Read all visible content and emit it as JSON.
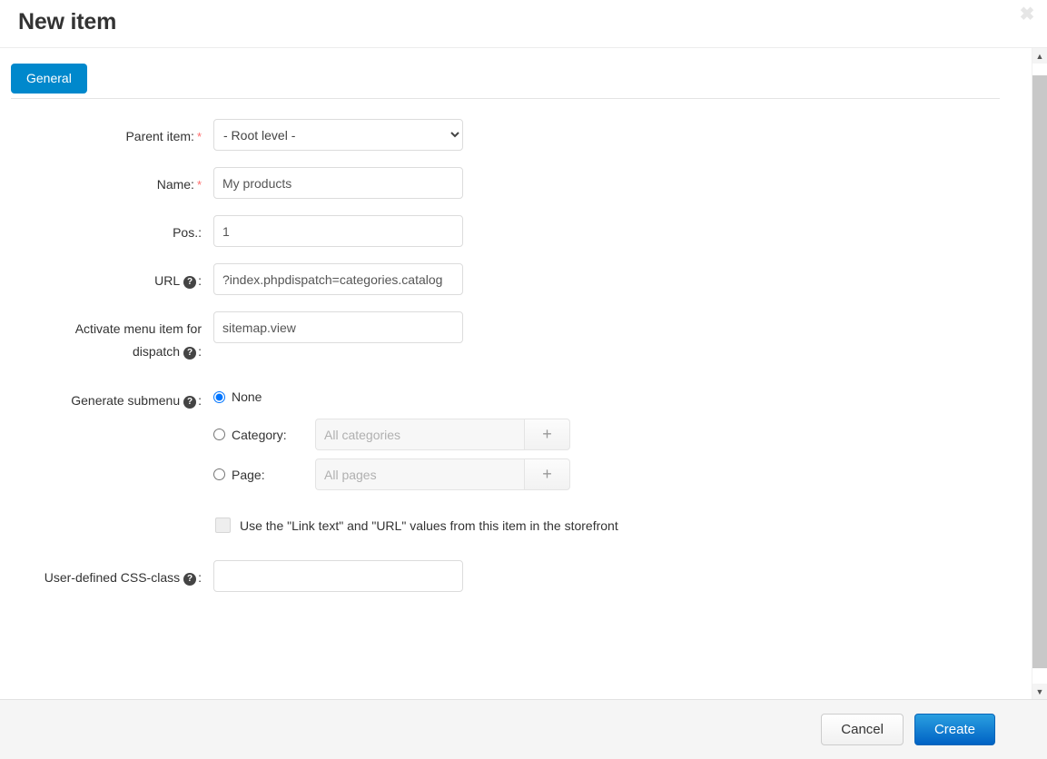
{
  "dialog": {
    "title": "New item",
    "close_label": "✖"
  },
  "tabs": [
    {
      "label": "General",
      "active": true
    }
  ],
  "form": {
    "parent_item": {
      "label": "Parent item:",
      "required_mark": "*",
      "value": "- Root level -",
      "options": [
        "- Root level -"
      ]
    },
    "name": {
      "label": "Name:",
      "required_mark": "*",
      "value": "My products",
      "placeholder": ""
    },
    "pos": {
      "label": "Pos.:",
      "value": "1",
      "placeholder": ""
    },
    "url": {
      "label": "URL",
      "label_suffix": ":",
      "help_icon": "question-mark-icon",
      "value": "?index.phpdispatch=categories.catalog",
      "placeholder": ""
    },
    "dispatch": {
      "label_line1": "Activate menu item for",
      "label_line2": "dispatch",
      "label_suffix": ":",
      "help_icon": "question-mark-icon",
      "value": "sitemap.view",
      "placeholder": ""
    },
    "generate_submenu": {
      "label": "Generate submenu",
      "label_suffix": ":",
      "help_icon": "question-mark-icon",
      "options": [
        {
          "label": "None",
          "selected": true
        },
        {
          "label": "Category:",
          "selected": false,
          "input_placeholder": "All categories",
          "input_value": "",
          "add_button": "+",
          "disabled": true
        },
        {
          "label": "Page:",
          "selected": false,
          "input_placeholder": "All pages",
          "input_value": "",
          "add_button": "+",
          "disabled": true
        }
      ]
    },
    "storefront_checkbox": {
      "label": "Use the \"Link text\" and \"URL\" values from this item in the storefront",
      "checked": false,
      "disabled": true
    },
    "css_class": {
      "label": "User-defined CSS-class",
      "label_suffix": ":",
      "help_icon": "question-mark-icon",
      "value": "",
      "placeholder": ""
    }
  },
  "footer": {
    "cancel_label": "Cancel",
    "create_label": "Create"
  },
  "scrollbar": {
    "up_arrow": "▲",
    "down_arrow": "▼"
  },
  "colors": {
    "accent_blue": "#0088cc",
    "create_button_blue": "#0062c4",
    "required_red": "#ff6b6b",
    "footer_background": "#f5f5f5"
  }
}
